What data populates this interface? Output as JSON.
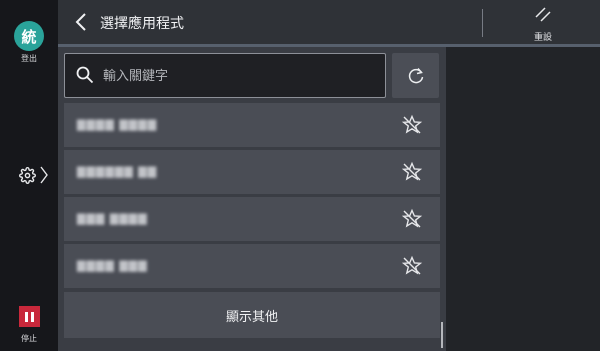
{
  "user": {
    "badge": "統",
    "logout_label": "登出"
  },
  "rail": {
    "settings_icon": "gear-icon",
    "expand_icon": "chevron-right-icon",
    "stop_label": "停止"
  },
  "header": {
    "title": "選擇應用程式",
    "reset_label": "重設",
    "back_icon": "back-arrow-icon"
  },
  "search": {
    "placeholder": "輸入關鍵字",
    "value": ""
  },
  "apps": [
    {
      "name": "▇▇▇▇ ▇▇▇▇",
      "pin_icon": "unpinned-icon"
    },
    {
      "name": "▇▇▇▇▇▇ ▇▇",
      "pin_icon": "unpinned-icon"
    },
    {
      "name": "▇▇▇  ▇▇▇▇",
      "pin_icon": "unpinned-icon"
    },
    {
      "name": "▇▇▇▇ ▇▇▇",
      "pin_icon": "unpinned-icon"
    }
  ],
  "more_label": "顯示其他",
  "colors": {
    "accent": "#2aa39a",
    "stop": "#c8283b",
    "header_line": "#57606d"
  }
}
